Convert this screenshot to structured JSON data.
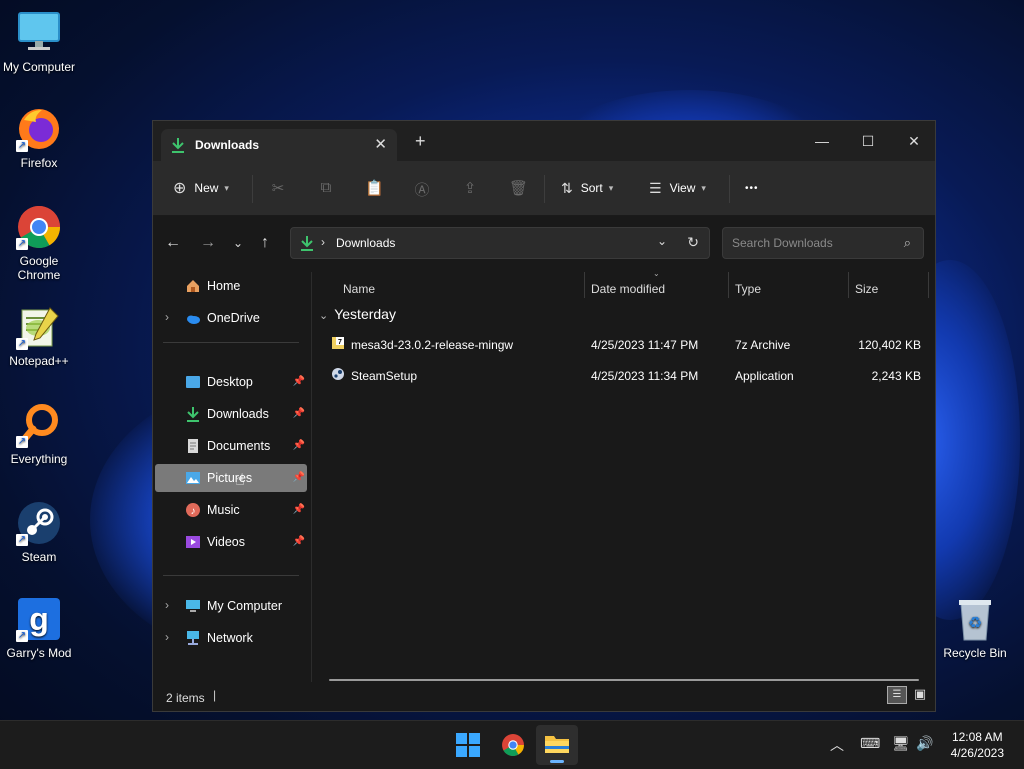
{
  "desktop": {
    "icons": [
      {
        "label": "My Computer"
      },
      {
        "label": "Firefox"
      },
      {
        "label": "Google\nChrome"
      },
      {
        "label": "Notepad++"
      },
      {
        "label": "Everything"
      },
      {
        "label": "Steam"
      },
      {
        "label": "Garry's Mod"
      },
      {
        "label": "Recycle Bin"
      }
    ]
  },
  "window": {
    "tab_title": "Downloads",
    "toolbar": {
      "new_label": "New",
      "sort_label": "Sort",
      "view_label": "View",
      "more_label": "•••"
    },
    "address": {
      "crumb": "Downloads",
      "search_placeholder": "Search Downloads"
    },
    "sidebar": {
      "items": [
        {
          "label": "Home"
        },
        {
          "label": "OneDrive"
        },
        {
          "label": "Desktop"
        },
        {
          "label": "Downloads"
        },
        {
          "label": "Documents"
        },
        {
          "label": "Pictures"
        },
        {
          "label": "Music"
        },
        {
          "label": "Videos"
        },
        {
          "label": "My Computer"
        },
        {
          "label": "Network"
        }
      ]
    },
    "columns": {
      "name": "Name",
      "date": "Date modified",
      "type": "Type",
      "size": "Size"
    },
    "group_label": "Yesterday",
    "files": [
      {
        "name": "mesa3d-23.0.2-release-mingw",
        "date": "4/25/2023 11:47 PM",
        "type": "7z Archive",
        "size": "120,402 KB"
      },
      {
        "name": "SteamSetup",
        "date": "4/25/2023 11:34 PM",
        "type": "Application",
        "size": "2,243 KB"
      }
    ],
    "status": "2 items"
  },
  "taskbar": {
    "time": "12:08 AM",
    "date": "4/26/2023"
  },
  "colors": {
    "accent_green": "#3ec46d",
    "selection": "#7a7a7a",
    "window_bg": "#191919",
    "toolbar_bg": "#2b2b2b"
  }
}
